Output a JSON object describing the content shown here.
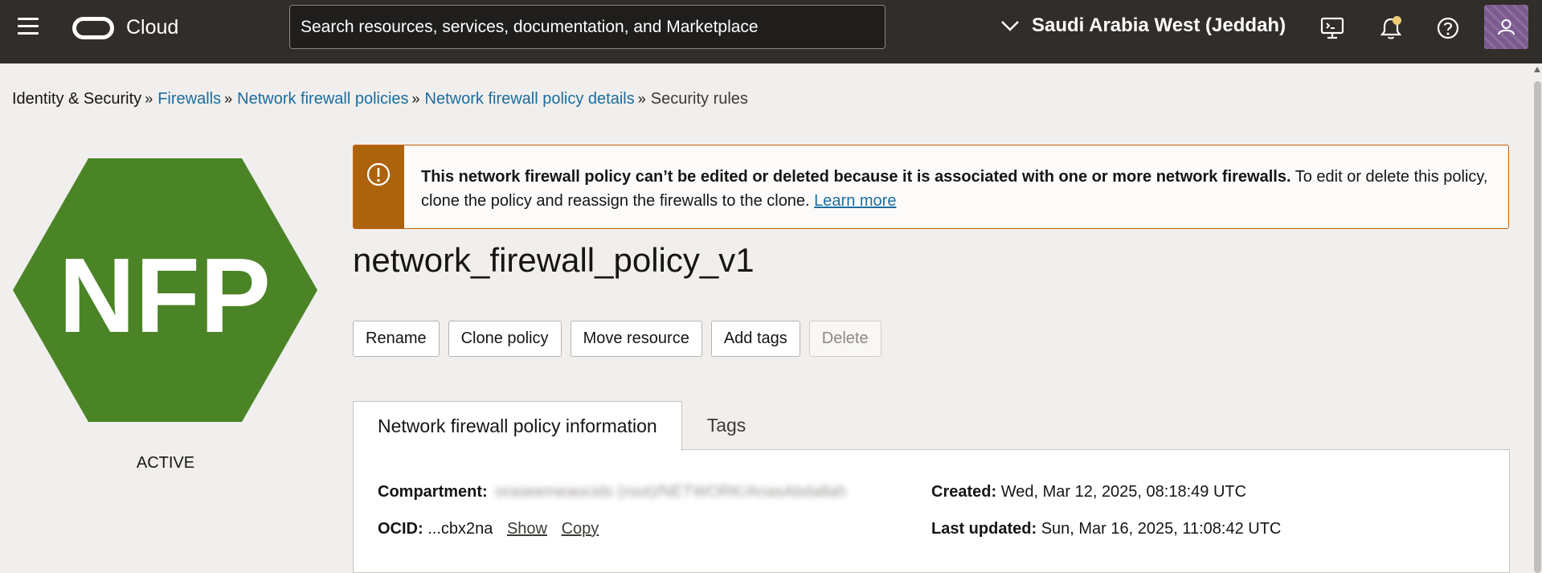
{
  "header": {
    "brand": "Cloud",
    "search_placeholder": "Search resources, services, documentation, and Marketplace",
    "region": "Saudi Arabia West (Jeddah)",
    "icons": [
      "menu-icon",
      "cloud-shell-icon",
      "bell-icon",
      "help-icon",
      "user-avatar"
    ]
  },
  "breadcrumb": {
    "root": "Identity & Security",
    "items": [
      "Firewalls",
      "Network firewall policies",
      "Network firewall policy details"
    ],
    "current": "Security rules"
  },
  "badge": {
    "text": "NFP",
    "color": "#4b8427",
    "status": "ACTIVE"
  },
  "alert": {
    "bold": "This network firewall policy can’t be edited or deleted because it is associated with one or more network firewalls.",
    "text": " To edit or delete this policy, clone the policy and reassign the firewalls to the clone. ",
    "link": "Learn more",
    "color": "#ac630c"
  },
  "title": "network_firewall_policy_v1",
  "actions": {
    "rename": "Rename",
    "clone": "Clone policy",
    "move": "Move resource",
    "tags": "Add tags",
    "delete": "Delete"
  },
  "tabs": {
    "info": "Network firewall policy information",
    "tags": "Tags"
  },
  "details": {
    "compartment_label": "Compartment:",
    "compartment_value": "oraseemeaocids (root)/NETWORK/AnasAbdallah",
    "ocid_label": "OCID:",
    "ocid_value": "...cbx2na",
    "show": "Show",
    "copy": "Copy",
    "created_label": "Created:",
    "created_value": "Wed, Mar 12, 2025, 08:18:49 UTC",
    "updated_label": "Last updated:",
    "updated_value": "Sun, Mar 16, 2025, 11:08:42 UTC"
  }
}
